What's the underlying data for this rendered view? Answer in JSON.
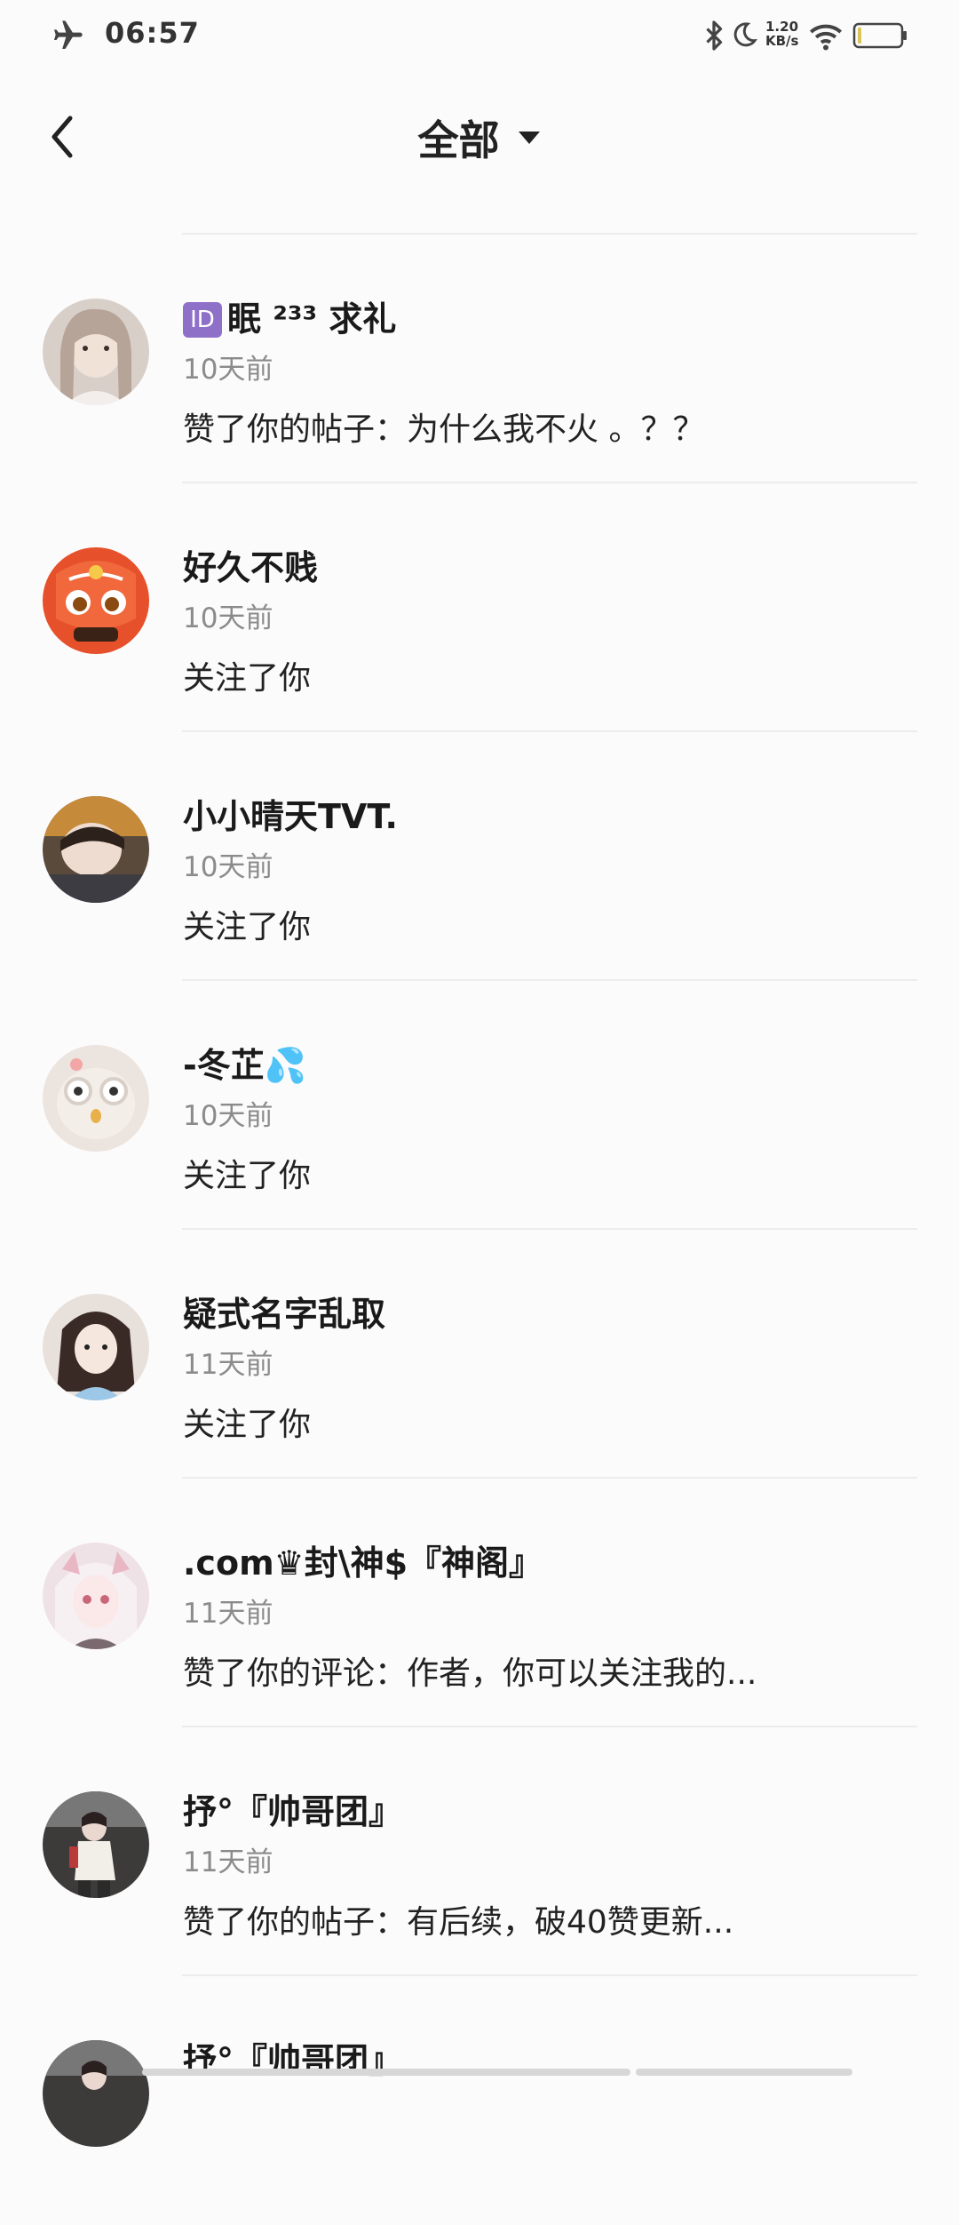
{
  "status_bar": {
    "time": "06:57",
    "net_speed_value": "1.20",
    "net_speed_unit": "KB/s",
    "icons": [
      "airplane-icon",
      "bluetooth-icon",
      "moon-icon",
      "wifi-icon",
      "battery-icon"
    ]
  },
  "header": {
    "back_icon": "chevron-left-icon",
    "title": "全部",
    "dropdown_icon": "triangle-down-icon"
  },
  "notifications": [
    {
      "badge": "ID",
      "name": "眠 ²³³ 求礼",
      "time": "10天前",
      "message": "赞了你的帖子：为什么我不火 。？？"
    },
    {
      "name": "好久不贱",
      "time": "10天前",
      "message": "关注了你"
    },
    {
      "name": "小小晴天TVT.",
      "time": "10天前",
      "message": "关注了你"
    },
    {
      "name": "-冬芷💦",
      "time": "10天前",
      "message": "关注了你"
    },
    {
      "name": "疑式名字乱取",
      "time": "11天前",
      "message": "关注了你"
    },
    {
      "name": ".com♛封\\神$『神阁』",
      "time": "11天前",
      "message": "赞了你的评论：作者，你可以关注我的..."
    },
    {
      "name": "抒°『帅哥团』",
      "time": "11天前",
      "message": "赞了你的帖子：有后续，破40赞更新..."
    },
    {
      "name": "抒°『帅哥团』"
    }
  ],
  "colors": {
    "background": "#fcfbfc",
    "text_primary": "#1a1a1a",
    "text_secondary": "#8b8b8b",
    "divider": "#ececec",
    "id_badge": "#8e70c9"
  }
}
